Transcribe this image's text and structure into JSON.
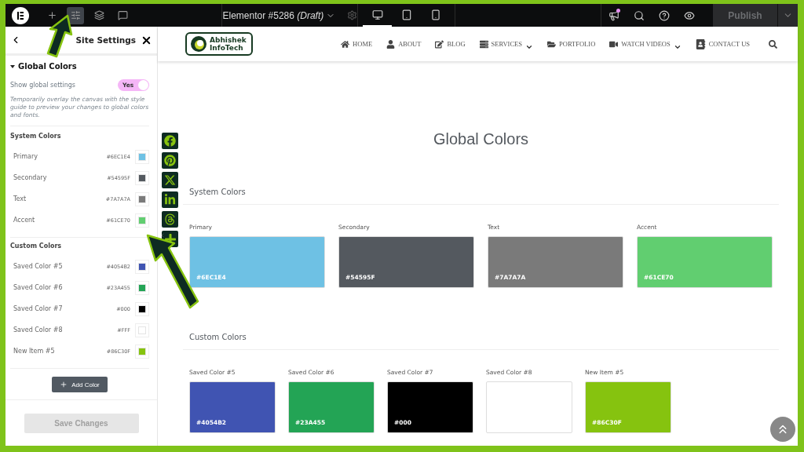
{
  "topbar": {
    "document_title": "Elementor #5286",
    "document_status": "(Draft)",
    "tools": [
      {
        "kind": "add",
        "selected": false
      },
      {
        "kind": "settings",
        "selected": true
      },
      {
        "kind": "layers",
        "selected": false
      },
      {
        "kind": "comments",
        "selected": false
      }
    ],
    "devices": [
      {
        "kind": "desktop",
        "selected": true
      },
      {
        "kind": "tablet",
        "selected": false
      },
      {
        "kind": "mobile",
        "selected": false
      }
    ],
    "notification_dot": true,
    "publish": {
      "label": "Publish",
      "disabled": true
    }
  },
  "panel": {
    "title": "Site Settings",
    "section": {
      "title": "Global Colors",
      "expanded": true
    },
    "toggle": {
      "label": "Show global settings",
      "text": "Yes",
      "on": true
    },
    "description": "Temporarily overlay the canvas with the style guide to preview your changes to global colors and fonts.",
    "groups": [
      {
        "title": "System Colors",
        "items": [
          {
            "name": "Primary",
            "value": "#6EC1E4",
            "color": "#6ec1e4"
          },
          {
            "name": "Secondary",
            "value": "#54595F",
            "color": "#54595f"
          },
          {
            "name": "Text",
            "value": "#7A7A7A",
            "color": "#7a7a7a"
          },
          {
            "name": "Accent",
            "value": "#61CE70",
            "color": "#61ce70"
          }
        ]
      },
      {
        "title": "Custom Colors",
        "items": [
          {
            "name": "Saved Color #5",
            "value": "#4054B2",
            "color": "#4054b2"
          },
          {
            "name": "Saved Color #6",
            "value": "#23A455",
            "color": "#23a455"
          },
          {
            "name": "Saved Color #7",
            "value": "#000",
            "color": "#000000"
          },
          {
            "name": "Saved Color #8",
            "value": "#FFF",
            "color": "#ffffff"
          },
          {
            "name": "New Item #5",
            "value": "#86C30F",
            "color": "#86c30f"
          }
        ]
      }
    ],
    "add_button": "Add Color",
    "save_button": {
      "label": "Save Changes",
      "disabled": true
    }
  },
  "site": {
    "logo": [
      "Abhishek",
      "InfoTech"
    ],
    "nav": [
      {
        "label": "HOME",
        "kind": "home",
        "dropdown": false
      },
      {
        "label": "ABOUT",
        "kind": "user",
        "dropdown": false
      },
      {
        "label": "BLOG",
        "kind": "edit",
        "dropdown": false
      },
      {
        "label": "SERVICES",
        "kind": "server",
        "dropdown": true
      },
      {
        "label": "PORTFOLIO",
        "kind": "folder",
        "dropdown": false
      },
      {
        "label": "WATCH VIDEOS",
        "kind": "video",
        "dropdown": true
      },
      {
        "label": "CONTACT US",
        "kind": "contact",
        "dropdown": false
      }
    ],
    "social": [
      {
        "kind": "facebook"
      },
      {
        "kind": "pinterest"
      },
      {
        "kind": "x"
      },
      {
        "kind": "linkedin"
      },
      {
        "kind": "threads"
      },
      {
        "kind": "plus"
      }
    ],
    "heading": "Global Colors",
    "sections": [
      {
        "title": "System Colors",
        "swatches": [
          {
            "name": "Primary",
            "value": "#6EC1E4",
            "color": "#6ec1e4"
          },
          {
            "name": "Secondary",
            "value": "#54595F",
            "color": "#54595f"
          },
          {
            "name": "Text",
            "value": "#7A7A7A",
            "color": "#7a7a7a"
          },
          {
            "name": "Accent",
            "value": "#61CE70",
            "color": "#61ce70"
          }
        ]
      },
      {
        "title": "Custom Colors",
        "swatches": [
          {
            "name": "Saved Color #5",
            "value": "#4054B2",
            "color": "#4054b2"
          },
          {
            "name": "Saved Color #6",
            "value": "#23A455",
            "color": "#23a455"
          },
          {
            "name": "Saved Color #7",
            "value": "#000",
            "color": "#000000"
          },
          {
            "name": "Saved Color #8",
            "color": "#ffffff"
          },
          {
            "name": "New Item #5",
            "value": "#86C30F",
            "color": "#86c30f"
          }
        ]
      }
    ]
  }
}
